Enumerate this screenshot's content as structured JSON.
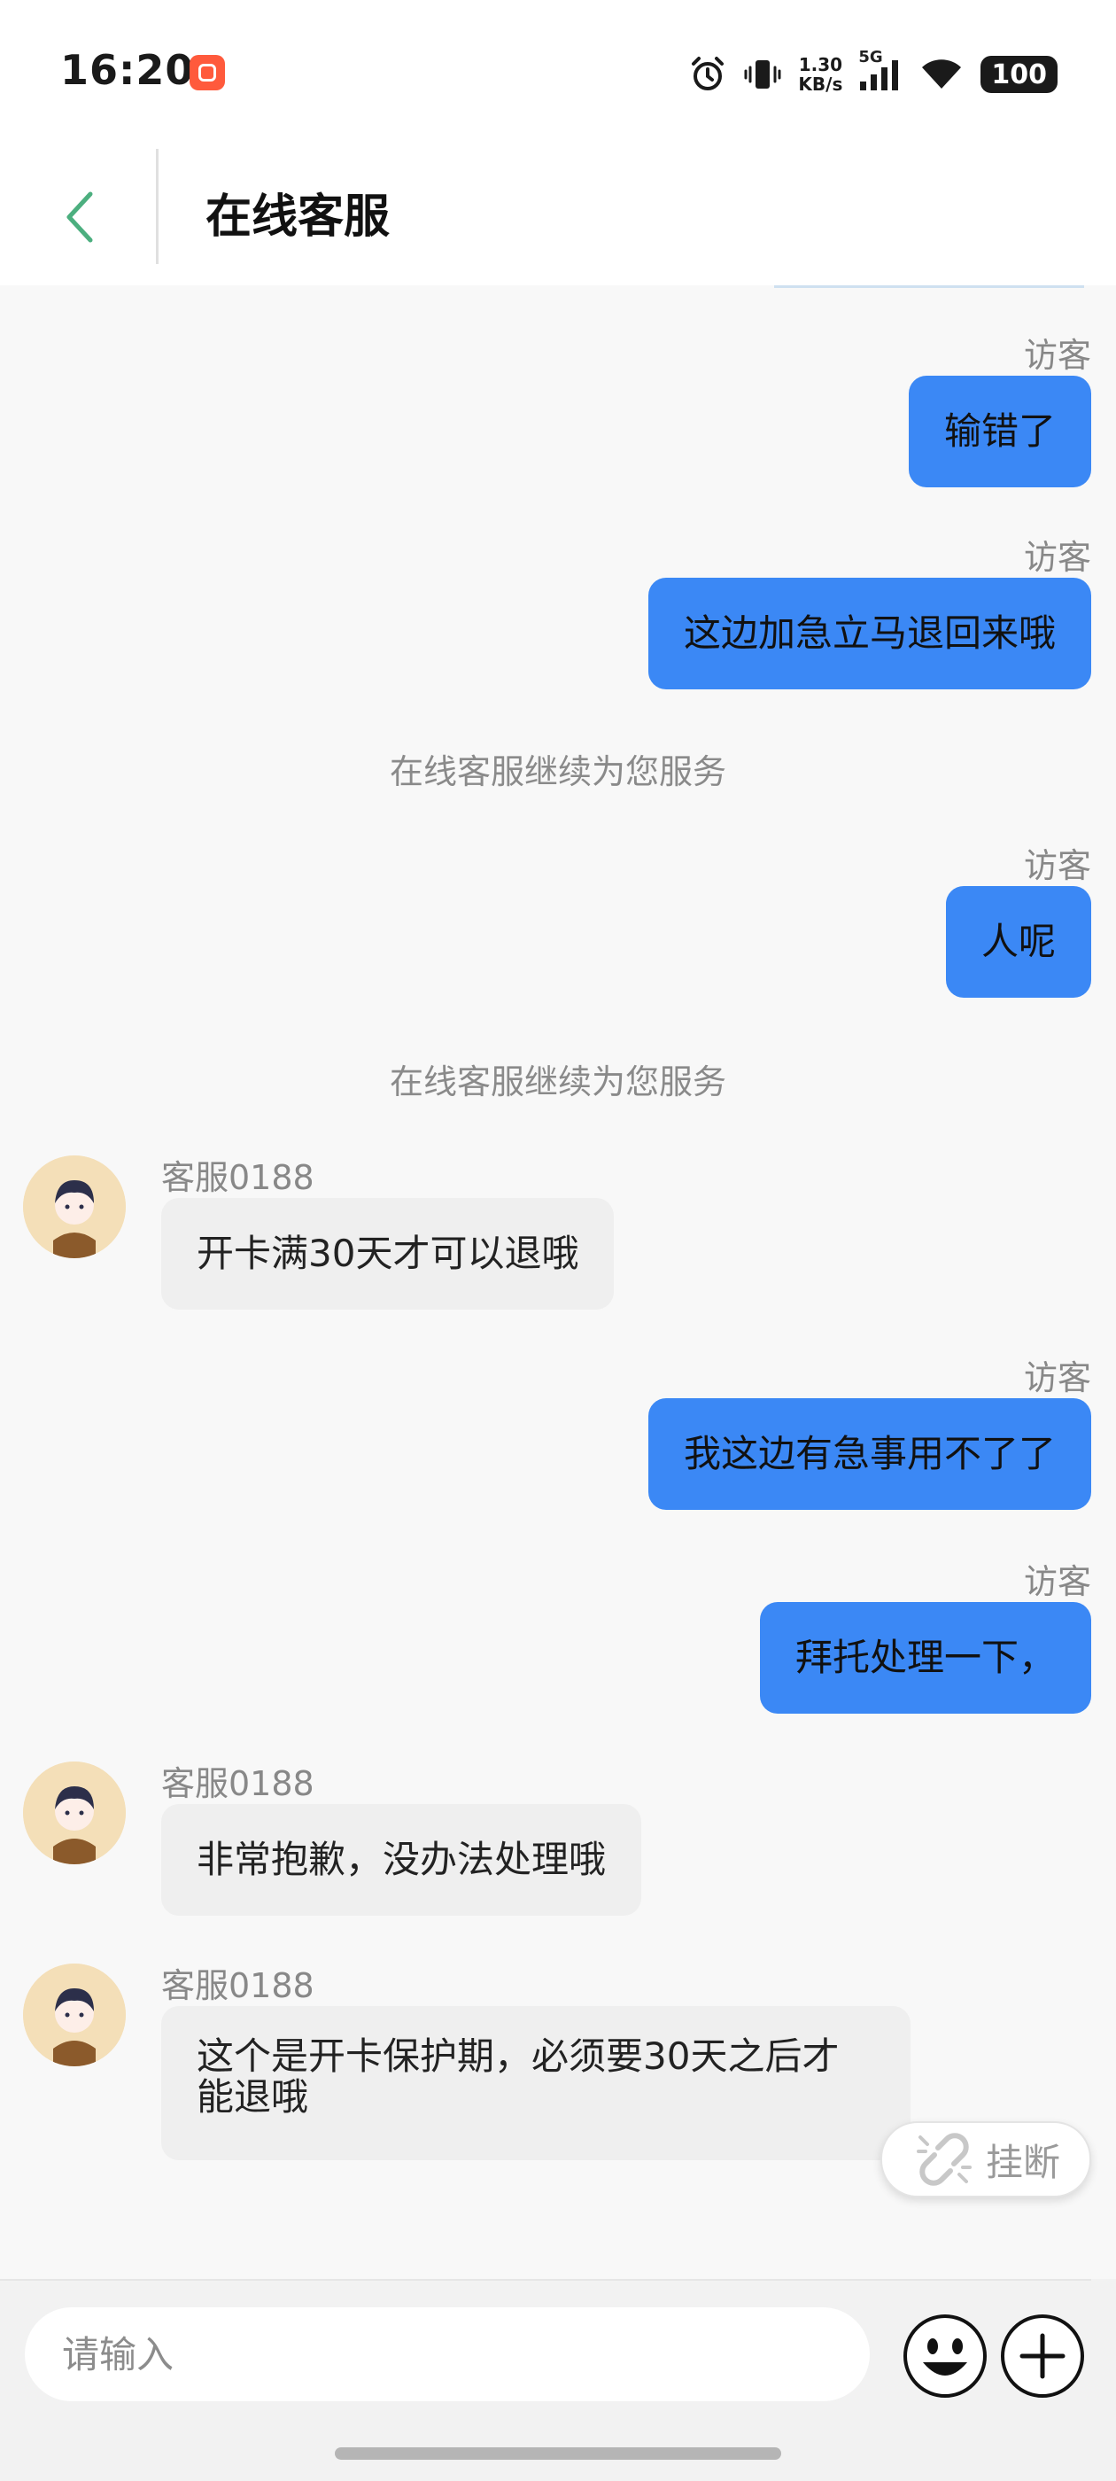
{
  "status_bar": {
    "time": "16:20",
    "network_speed_value": "1.30",
    "network_speed_unit": "KB/s",
    "network_type": "5G",
    "battery": "100",
    "icons": [
      "alarm-icon",
      "vibrate-icon",
      "signal-icon",
      "wifi-icon",
      "battery-icon"
    ]
  },
  "header": {
    "title": "在线客服",
    "back_icon": "chevron-left-icon",
    "accent_color": "#4caf7f"
  },
  "messages": [
    {
      "type": "visitor",
      "sender": "访客",
      "text": "输错了"
    },
    {
      "type": "visitor",
      "sender": "访客",
      "text": "这边加急立马退回来哦"
    },
    {
      "type": "system",
      "text": "在线客服继续为您服务"
    },
    {
      "type": "visitor",
      "sender": "访客",
      "text": "人呢"
    },
    {
      "type": "system",
      "text": "在线客服继续为您服务"
    },
    {
      "type": "agent",
      "sender": "客服0188",
      "text": "开卡满30天才可以退哦"
    },
    {
      "type": "visitor",
      "sender": "访客",
      "text": "我这边有急事用不了了"
    },
    {
      "type": "visitor",
      "sender": "访客",
      "text": "拜托处理一下，"
    },
    {
      "type": "agent",
      "sender": "客服0188",
      "text": "非常抱歉，没办法处理哦"
    },
    {
      "type": "agent",
      "sender": "客服0188",
      "text": "这个是开卡保护期，必须要30天之后才能退哦"
    }
  ],
  "hangup": {
    "label": "挂断",
    "icon": "broken-link-icon"
  },
  "input": {
    "placeholder": "请输入",
    "value": ""
  },
  "colors": {
    "visitor_bubble": "#3b88f5",
    "agent_bubble": "#efefef",
    "background": "#f8f8f8"
  }
}
